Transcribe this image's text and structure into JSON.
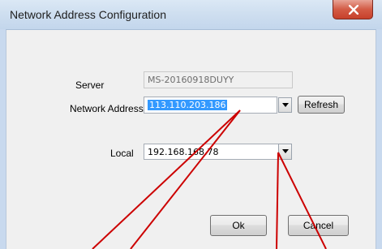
{
  "window": {
    "title": "Network Address Configuration",
    "close_icon": "close-x-icon"
  },
  "form": {
    "server_label": "Server",
    "server_value": "MS-20160918DUYY",
    "network_address_label": "Network Address",
    "network_address_value": "113.110.203.186",
    "refresh_label": "Refresh",
    "local_label": "Local",
    "local_value": "192.168.168.78",
    "dropdown_icon": "chevron-down-icon"
  },
  "buttons": {
    "ok_label": "Ok",
    "cancel_label": "Cancel"
  },
  "annotation": {
    "line_color": "#cc0000"
  }
}
